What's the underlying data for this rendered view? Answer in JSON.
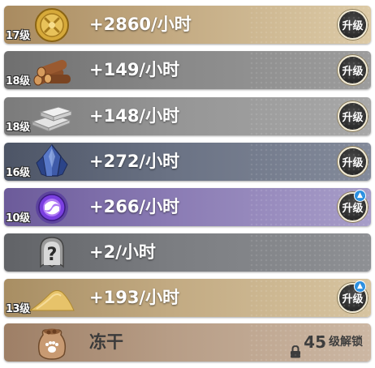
{
  "resources": [
    {
      "id": "gold",
      "level": "17级",
      "rate": "+2860/小时",
      "upgrade_label": "升级",
      "has_notice": false,
      "icon": "gold-coin-icon",
      "bg": "#c3aa82"
    },
    {
      "id": "wood",
      "level": "18级",
      "rate": "+149/小时",
      "upgrade_label": "升级",
      "has_notice": false,
      "icon": "wood-logs-icon",
      "bg": "#888888"
    },
    {
      "id": "stone",
      "level": "18级",
      "rate": "+148/小时",
      "upgrade_label": "升级",
      "has_notice": false,
      "icon": "stone-bricks-icon",
      "bg": "#959595"
    },
    {
      "id": "crystal",
      "level": "16级",
      "rate": "+272/小时",
      "upgrade_label": "升级",
      "has_notice": false,
      "icon": "blue-crystal-icon",
      "bg": "#6a7284"
    },
    {
      "id": "orb",
      "level": "10级",
      "rate": "+266/小时",
      "upgrade_label": "升级",
      "has_notice": true,
      "icon": "purple-orb-icon",
      "bg": "#8a7bb4"
    },
    {
      "id": "mystery",
      "level": "",
      "rate": "+2/小时",
      "upgrade_label": "",
      "has_notice": false,
      "icon": "mystery-helmet-icon",
      "bg": "#7b7d81"
    },
    {
      "id": "sand",
      "level": "13级",
      "rate": "+193/小时",
      "upgrade_label": "升级",
      "has_notice": true,
      "icon": "sand-pile-icon",
      "bg": "#c2aa82"
    }
  ],
  "locked": {
    "name": "冻干",
    "icon": "treat-bag-icon",
    "unlock_level": "45",
    "unlock_text": "级解锁"
  }
}
